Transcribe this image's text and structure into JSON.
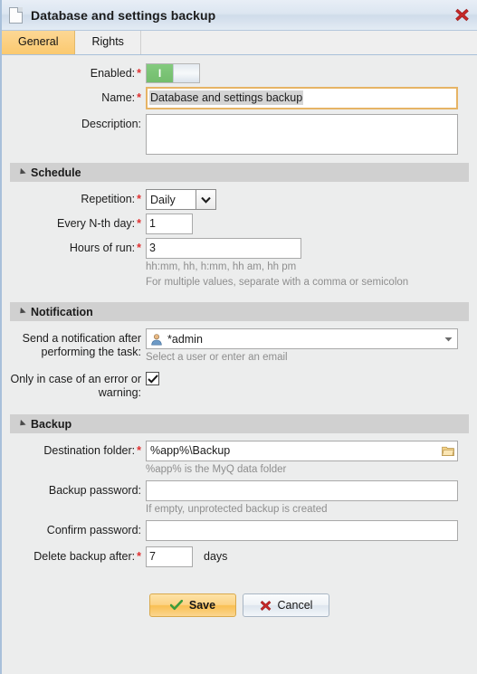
{
  "window": {
    "title": "Database and settings backup",
    "doc_icon": "document-icon",
    "close_icon": "close-icon"
  },
  "tabs": [
    {
      "label": "General",
      "active": true
    },
    {
      "label": "Rights",
      "active": false
    }
  ],
  "general": {
    "enabled": {
      "label": "Enabled:",
      "required": "*",
      "state": "on",
      "on_glyph": "I"
    },
    "name": {
      "label": "Name:",
      "required": "*",
      "value": "Database and settings backup",
      "selected": true
    },
    "description": {
      "label": "Description:",
      "value": ""
    }
  },
  "schedule": {
    "header": "Schedule",
    "repetition": {
      "label": "Repetition:",
      "required": "*",
      "value": "Daily",
      "options": [
        "Daily"
      ]
    },
    "every_nth_day": {
      "label": "Every N-th day:",
      "required": "*",
      "value": "1"
    },
    "hours_of_run": {
      "label": "Hours of run:",
      "required": "*",
      "value": "3",
      "hint_line1": "hh:mm, hh, h:mm, hh am, hh pm",
      "hint_line2": "For multiple values, separate with a comma or semicolon"
    }
  },
  "notification": {
    "header": "Notification",
    "send_after": {
      "label_line1": "Send a notification after",
      "label_line2": "performing the task:",
      "value": "*admin",
      "avatar_icon": "user-avatar-icon",
      "hint": "Select a user or enter an email"
    },
    "only_error": {
      "label_line1": "Only in case of an error or",
      "label_line2": "warning:",
      "checked": true
    }
  },
  "backup": {
    "header": "Backup",
    "destination_folder": {
      "label": "Destination folder:",
      "required": "*",
      "value": "%app%\\Backup",
      "browse_icon": "folder-icon",
      "hint": "%app% is the MyQ data folder"
    },
    "backup_password": {
      "label": "Backup password:",
      "value": "",
      "hint": "If empty, unprotected backup is created"
    },
    "confirm_password": {
      "label": "Confirm password:",
      "value": ""
    },
    "delete_after": {
      "label": "Delete backup after:",
      "required": "*",
      "value": "7",
      "unit": "days"
    }
  },
  "footer": {
    "save_label": "Save",
    "save_icon": "checkmark-icon",
    "cancel_label": "Cancel",
    "cancel_icon": "x-icon"
  },
  "colors": {
    "accent_orange": "#fbc96f",
    "required_red": "#e03030",
    "toggle_green": "#7bc475",
    "section_gray": "#d0d0d0",
    "titlebar_blue": "#dce6f1"
  }
}
